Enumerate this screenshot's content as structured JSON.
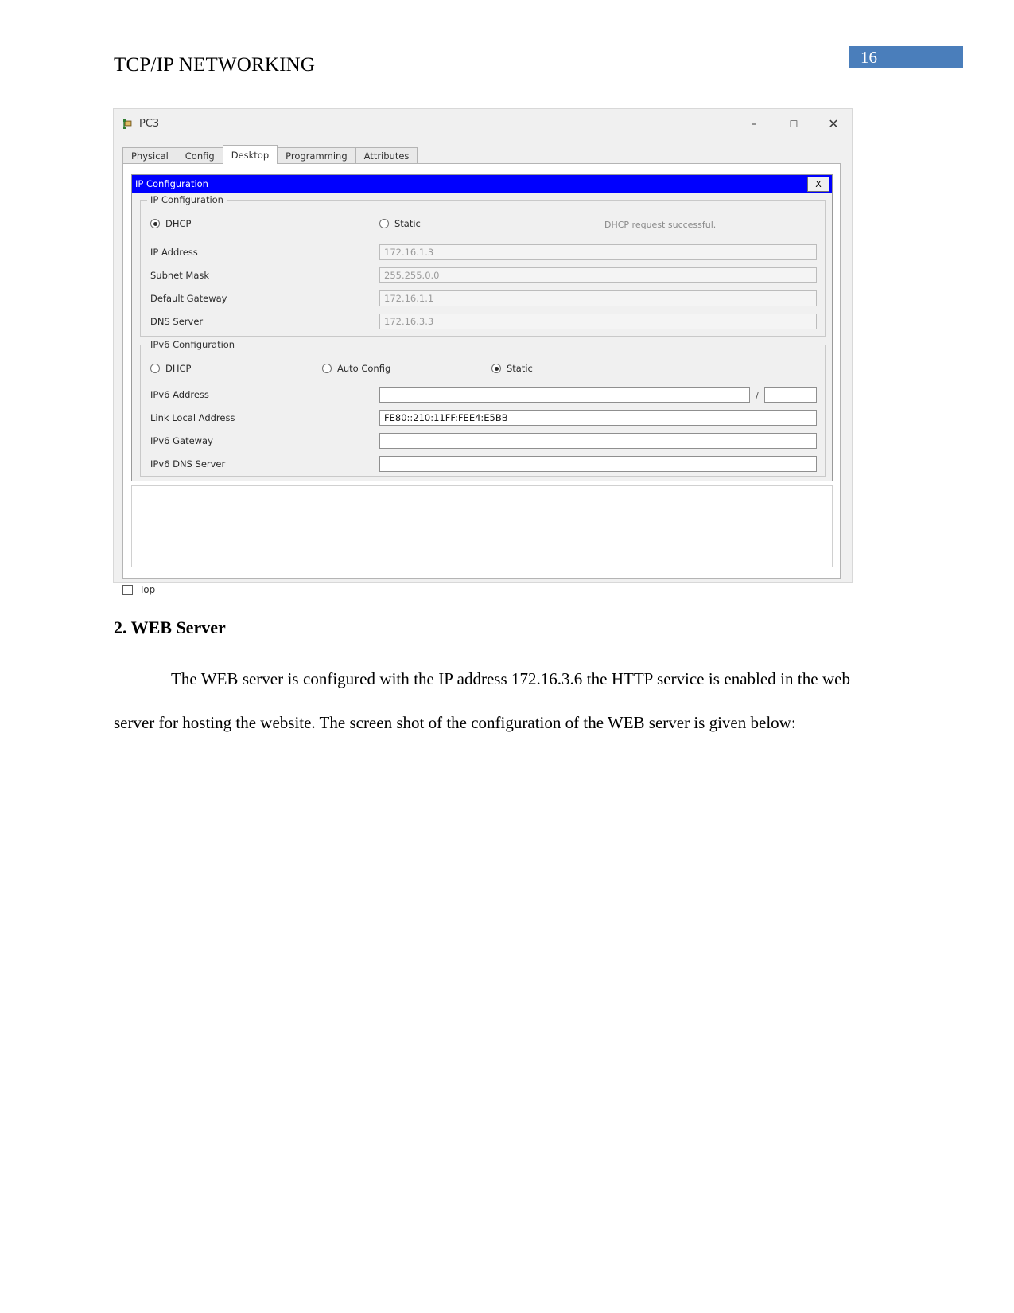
{
  "document": {
    "header_title": "TCP/IP NETWORKING",
    "page_number": "16",
    "badge_color": "#4A7EBB"
  },
  "window": {
    "title": "PC3",
    "icon": "pc-device-icon",
    "controls": {
      "minimize": "–",
      "maximize": "☐",
      "close": "✕"
    },
    "tabs": [
      {
        "label": "Physical",
        "active": false
      },
      {
        "label": "Config",
        "active": false
      },
      {
        "label": "Desktop",
        "active": true
      },
      {
        "label": "Programming",
        "active": false
      },
      {
        "label": "Attributes",
        "active": false
      }
    ],
    "bottom_checkbox": {
      "label": "Top",
      "checked": false
    }
  },
  "ip_config_window": {
    "title": "IP Configuration",
    "close_label": "X",
    "ipv4": {
      "legend": "IP Configuration",
      "mode_options": [
        {
          "label": "DHCP",
          "selected": true
        },
        {
          "label": "Static",
          "selected": false
        }
      ],
      "status": "DHCP request successful.",
      "fields": [
        {
          "label": "IP Address",
          "value": "172.16.1.3",
          "editable": false
        },
        {
          "label": "Subnet Mask",
          "value": "255.255.0.0",
          "editable": false
        },
        {
          "label": "Default Gateway",
          "value": "172.16.1.1",
          "editable": false
        },
        {
          "label": "DNS Server",
          "value": "172.16.3.3",
          "editable": false
        }
      ]
    },
    "ipv6": {
      "legend": "IPv6 Configuration",
      "mode_options": [
        {
          "label": "DHCP",
          "selected": false
        },
        {
          "label": "Auto Config",
          "selected": false
        },
        {
          "label": "Static",
          "selected": true
        }
      ],
      "address_label": "IPv6 Address",
      "address_value": "",
      "prefix_separator": "/",
      "prefix_value": "",
      "fields": [
        {
          "label": "Link Local Address",
          "value": "FE80::210:11FF:FEE4:E5BB",
          "editable": true
        },
        {
          "label": "IPv6 Gateway",
          "value": "",
          "editable": true
        },
        {
          "label": "IPv6 DNS Server",
          "value": "",
          "editable": true
        }
      ]
    }
  },
  "content": {
    "section_heading": "2. WEB Server",
    "paragraph": "The WEB server is configured with the IP address 172.16.3.6 the HTTP service is enabled in the web server for hosting the website. The screen shot of the configuration of the WEB server is given below:"
  }
}
